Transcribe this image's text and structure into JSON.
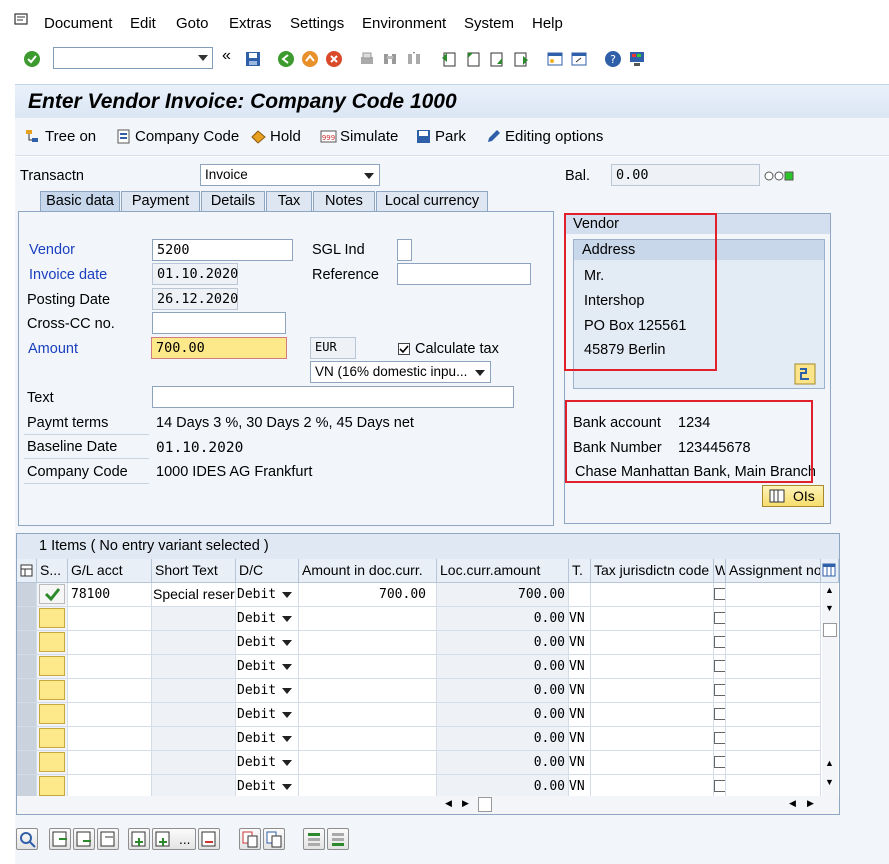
{
  "menu": {
    "items": [
      "Document",
      "Edit",
      "Goto",
      "Extras",
      "Settings",
      "Environment",
      "System",
      "Help"
    ]
  },
  "title": "Enter Vendor Invoice: Company Code 1000",
  "app_toolbar": {
    "tree_on": "Tree on",
    "company_code": "Company Code",
    "hold": "Hold",
    "simulate": "Simulate",
    "park": "Park",
    "editing_options": "Editing options"
  },
  "header": {
    "transactn_label": "Transactn",
    "transactn_value": "Invoice",
    "bal_label": "Bal.",
    "bal_value": "0.00"
  },
  "tabs": [
    "Basic data",
    "Payment",
    "Details",
    "Tax",
    "Notes",
    "Local currency"
  ],
  "basic": {
    "vendor_label": "Vendor",
    "vendor_value": "5200",
    "sgl_label": "SGL Ind",
    "invoice_date_label": "Invoice date",
    "invoice_date_value": "01.10.2020",
    "reference_label": "Reference",
    "posting_date_label": "Posting Date",
    "posting_date_value": "26.12.2020",
    "crosscc_label": "Cross-CC no.",
    "amount_label": "Amount",
    "amount_value": "700.00",
    "currency": "EUR",
    "calc_tax_label": "Calculate tax",
    "tax_code": "VN (16% domestic inpu...",
    "text_label": "Text",
    "paymt_terms_label": "Paymt terms",
    "paymt_terms_value": "14 Days 3 %, 30 Days 2 %, 45 Days net",
    "baseline_label": "Baseline Date",
    "baseline_value": "01.10.2020",
    "company_code_label": "Company Code",
    "company_code_value": "1000 IDES AG Frankfurt"
  },
  "vendor_panel": {
    "title": "Vendor",
    "address_title": "Address",
    "address_lines": [
      "Mr.",
      "Intershop",
      "PO Box 125561",
      "45879 Berlin"
    ],
    "bank_account_label": "Bank account",
    "bank_account_value": "1234",
    "bank_number_label": "Bank Number",
    "bank_number_value": "123445678",
    "bank_name": "Chase Manhattan Bank, Main Branch",
    "ois_button": "OIs"
  },
  "items_table": {
    "caption": "1 Items ( No entry variant selected )",
    "columns": [
      "S...",
      "G/L acct",
      "Short Text",
      "D/C",
      "Amount in doc.curr.",
      "Loc.curr.amount",
      "T.",
      "Tax jurisdictn code",
      "W",
      "Assignment no"
    ],
    "rows": [
      {
        "gl": "78100",
        "short_text": "Special reser...",
        "dc": "Debit",
        "amount": "700.00",
        "loc": "700.00",
        "tax": ""
      },
      {
        "gl": "",
        "short_text": "",
        "dc": "Debit",
        "amount": "",
        "loc": "0.00",
        "tax": "VN"
      },
      {
        "gl": "",
        "short_text": "",
        "dc": "Debit",
        "amount": "",
        "loc": "0.00",
        "tax": "VN"
      },
      {
        "gl": "",
        "short_text": "",
        "dc": "Debit",
        "amount": "",
        "loc": "0.00",
        "tax": "VN"
      },
      {
        "gl": "",
        "short_text": "",
        "dc": "Debit",
        "amount": "",
        "loc": "0.00",
        "tax": "VN"
      },
      {
        "gl": "",
        "short_text": "",
        "dc": "Debit",
        "amount": "",
        "loc": "0.00",
        "tax": "VN"
      },
      {
        "gl": "",
        "short_text": "",
        "dc": "Debit",
        "amount": "",
        "loc": "0.00",
        "tax": "VN"
      },
      {
        "gl": "",
        "short_text": "",
        "dc": "Debit",
        "amount": "",
        "loc": "0.00",
        "tax": "VN"
      },
      {
        "gl": "",
        "short_text": "",
        "dc": "Debit",
        "amount": "",
        "loc": "0.00",
        "tax": "VN"
      }
    ]
  },
  "colors": {
    "accent_blue": "#1a3fbf",
    "highlight_red": "#e0202a",
    "required_yellow": "#fde88a"
  }
}
